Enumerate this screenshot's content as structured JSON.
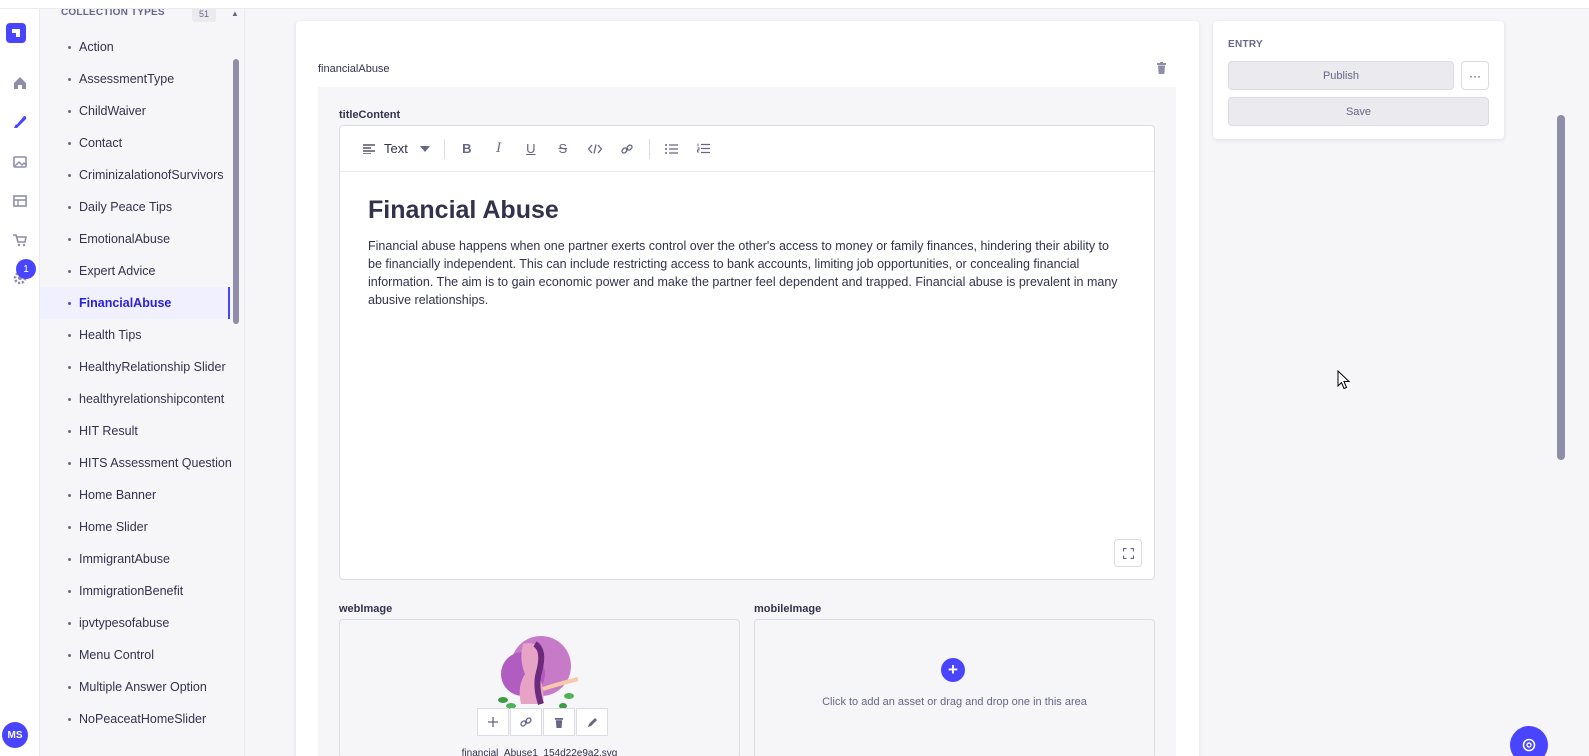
{
  "sidebar": {
    "header": "COLLECTION TYPES",
    "count": "51",
    "items": [
      {
        "label": "Action"
      },
      {
        "label": "AssessmentType"
      },
      {
        "label": "ChildWaiver"
      },
      {
        "label": "Contact"
      },
      {
        "label": "CriminizalationofSurvivors"
      },
      {
        "label": "Daily Peace Tips"
      },
      {
        "label": "EmotionalAbuse"
      },
      {
        "label": "Expert Advice"
      },
      {
        "label": "FinancialAbuse",
        "active": true
      },
      {
        "label": "Health Tips"
      },
      {
        "label": "HealthyRelationship Slider"
      },
      {
        "label": "healthyrelationshipcontent"
      },
      {
        "label": "HIT Result"
      },
      {
        "label": "HITS Assessment Question"
      },
      {
        "label": "Home Banner"
      },
      {
        "label": "Home Slider"
      },
      {
        "label": "ImmigrantAbuse"
      },
      {
        "label": "ImmigrationBenefit"
      },
      {
        "label": "ipvtypesofabuse"
      },
      {
        "label": "Menu Control"
      },
      {
        "label": "Multiple Answer Option"
      },
      {
        "label": "NoPeaceatHomeSlider"
      }
    ]
  },
  "nav": {
    "settings_badge": "1",
    "avatar_initials": "MS"
  },
  "component": {
    "title": "financialAbuse",
    "title_content_label": "titleContent",
    "editor": {
      "block_type": "Text",
      "heading": "Financial Abuse",
      "paragraph": "Financial abuse happens when one partner exerts control over the other's access to money or family finances, hindering their ability to be financially independent. This can include restricting access to bank accounts, limiting job opportunities, or concealing financial information. The aim is to gain economic power and make the partner feel dependent and trapped. Financial abuse is prevalent in many abusive relationships."
    },
    "web_image": {
      "label": "webImage",
      "filename": "financial_Abuse1_154d22e9a2.svg"
    },
    "mobile_image": {
      "label": "mobileImage",
      "hint": "Click to add an asset or drag and drop one in this area"
    }
  },
  "entry": {
    "label": "ENTRY",
    "publish": "Publish",
    "more": "···",
    "save": "Save"
  },
  "colors": {
    "accent": "#4945ff",
    "active_bg": "#f0f0ff",
    "text": "#32324d",
    "muted": "#666687"
  }
}
